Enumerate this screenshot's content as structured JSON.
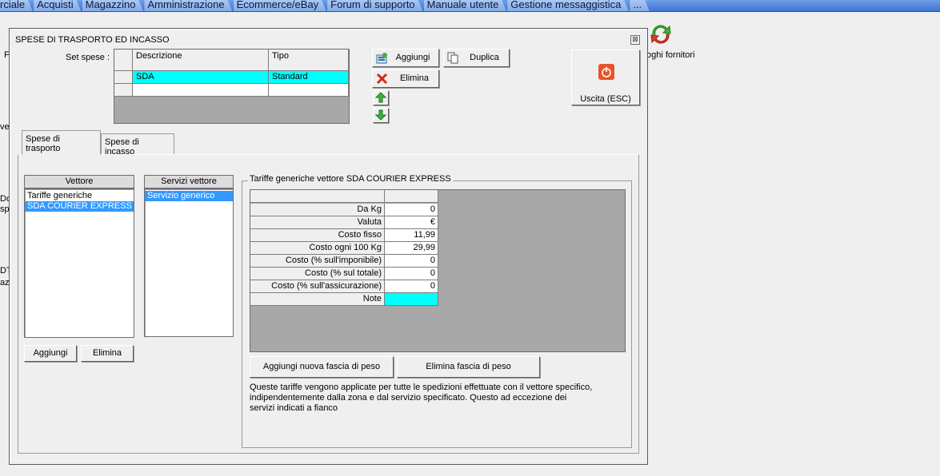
{
  "topmenu": [
    "rciale",
    "Acquisti",
    "Magazzino",
    "Amministrazione",
    "Ecommerce/eBay",
    "Forum di supporto",
    "Manuale utente",
    "Gestione messaggistica",
    "..."
  ],
  "background": {
    "fornitori_label": "oghi fornitori",
    "left_fragments": [
      "F",
      "ver",
      "Doc",
      "spo",
      "DT",
      "az"
    ]
  },
  "dialog": {
    "title": "SPESE DI TRASPORTO ED INCASSO",
    "close_glyph": "⊠",
    "set_spese_label": "Set spese :",
    "set_grid": {
      "headers": [
        "Descrizione",
        "Tipo"
      ],
      "rows": [
        {
          "descrizione": "SDA",
          "tipo": "Standard"
        }
      ]
    },
    "buttons": {
      "aggiungi": "Aggiungi",
      "duplica": "Duplica",
      "elimina": "Elimina",
      "uscita": "Uscita (ESC)"
    },
    "tabs": [
      "Spese di trasporto",
      "Spese di incasso"
    ],
    "vettore": {
      "header": "Vettore",
      "items": [
        "Tariffe generiche",
        "SDA COURIER EXPRESS"
      ],
      "selected_index": 1,
      "add_label": "Aggiungi",
      "delete_label": "Elimina"
    },
    "servizi": {
      "header": "Servizi vettore",
      "items": [
        "Servizio generico"
      ],
      "selected_index": 0
    },
    "tariffe": {
      "legend": "Tariffe generiche vettore SDA COURIER EXPRESS",
      "rows": [
        {
          "label": "Da Kg",
          "value": "0"
        },
        {
          "label": "Valuta",
          "value": "€"
        },
        {
          "label": "Costo fisso",
          "value": "11,99"
        },
        {
          "label": "Costo ogni 100 Kg",
          "value": "29,99"
        },
        {
          "label": "Costo (% sull'imponibile)",
          "value": "0"
        },
        {
          "label": "Costo (% sul totale)",
          "value": "0"
        },
        {
          "label": "Costo (% sull'assicurazione)",
          "value": "0"
        },
        {
          "label": "Note",
          "value": ""
        }
      ],
      "add_band_label": "Aggiungi nuova fascia di peso",
      "delete_band_label": "Elimina fascia di peso",
      "note_text": "Queste tariffe vengono applicate per tutte le spedizioni effettuate con il vettore specifico, indipendentemente dalla zona e dal servizio specificato. Questo ad eccezione dei servizi indicati a fianco"
    }
  },
  "colors": {
    "selected_row": "#00ffff",
    "list_selection": "#3399ff",
    "grid_background": "#a8a8a8",
    "menu_bar": "#3f74d4"
  }
}
